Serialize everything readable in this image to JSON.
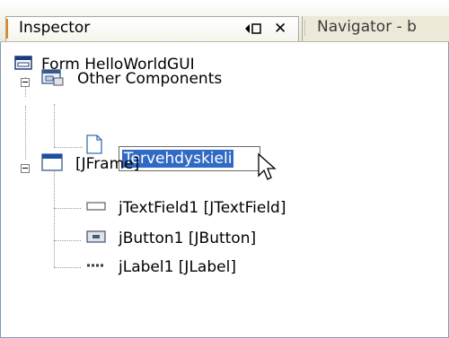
{
  "tabs": [
    {
      "label": "Inspector",
      "active": true
    },
    {
      "label": "Navigator - b",
      "active": false
    }
  ],
  "tab_controls": {
    "minimize_icon": "minimize-window-icon",
    "close_label": "✕"
  },
  "tree": {
    "root": {
      "label": "Form HelloWorldGUI",
      "icon": "form-icon"
    },
    "other_components": {
      "label": "Other Components",
      "icon": "components-icon",
      "expanded": true
    },
    "new_node": {
      "value": "Tervehdyskieli",
      "icon": "file-icon",
      "editing": true
    },
    "frame": {
      "label": "[JFrame]",
      "icon": "frame-icon",
      "expanded": true
    },
    "children": [
      {
        "label": "jTextField1 [JTextField]",
        "icon": "textfield-icon"
      },
      {
        "label": "jButton1 [JButton]",
        "icon": "button-icon"
      },
      {
        "label": "jLabel1 [JLabel]",
        "icon": "label-icon"
      }
    ]
  },
  "colors": {
    "selection": "#316ac5",
    "accent": "#e2861e",
    "tab_background": "#ece9d8"
  }
}
